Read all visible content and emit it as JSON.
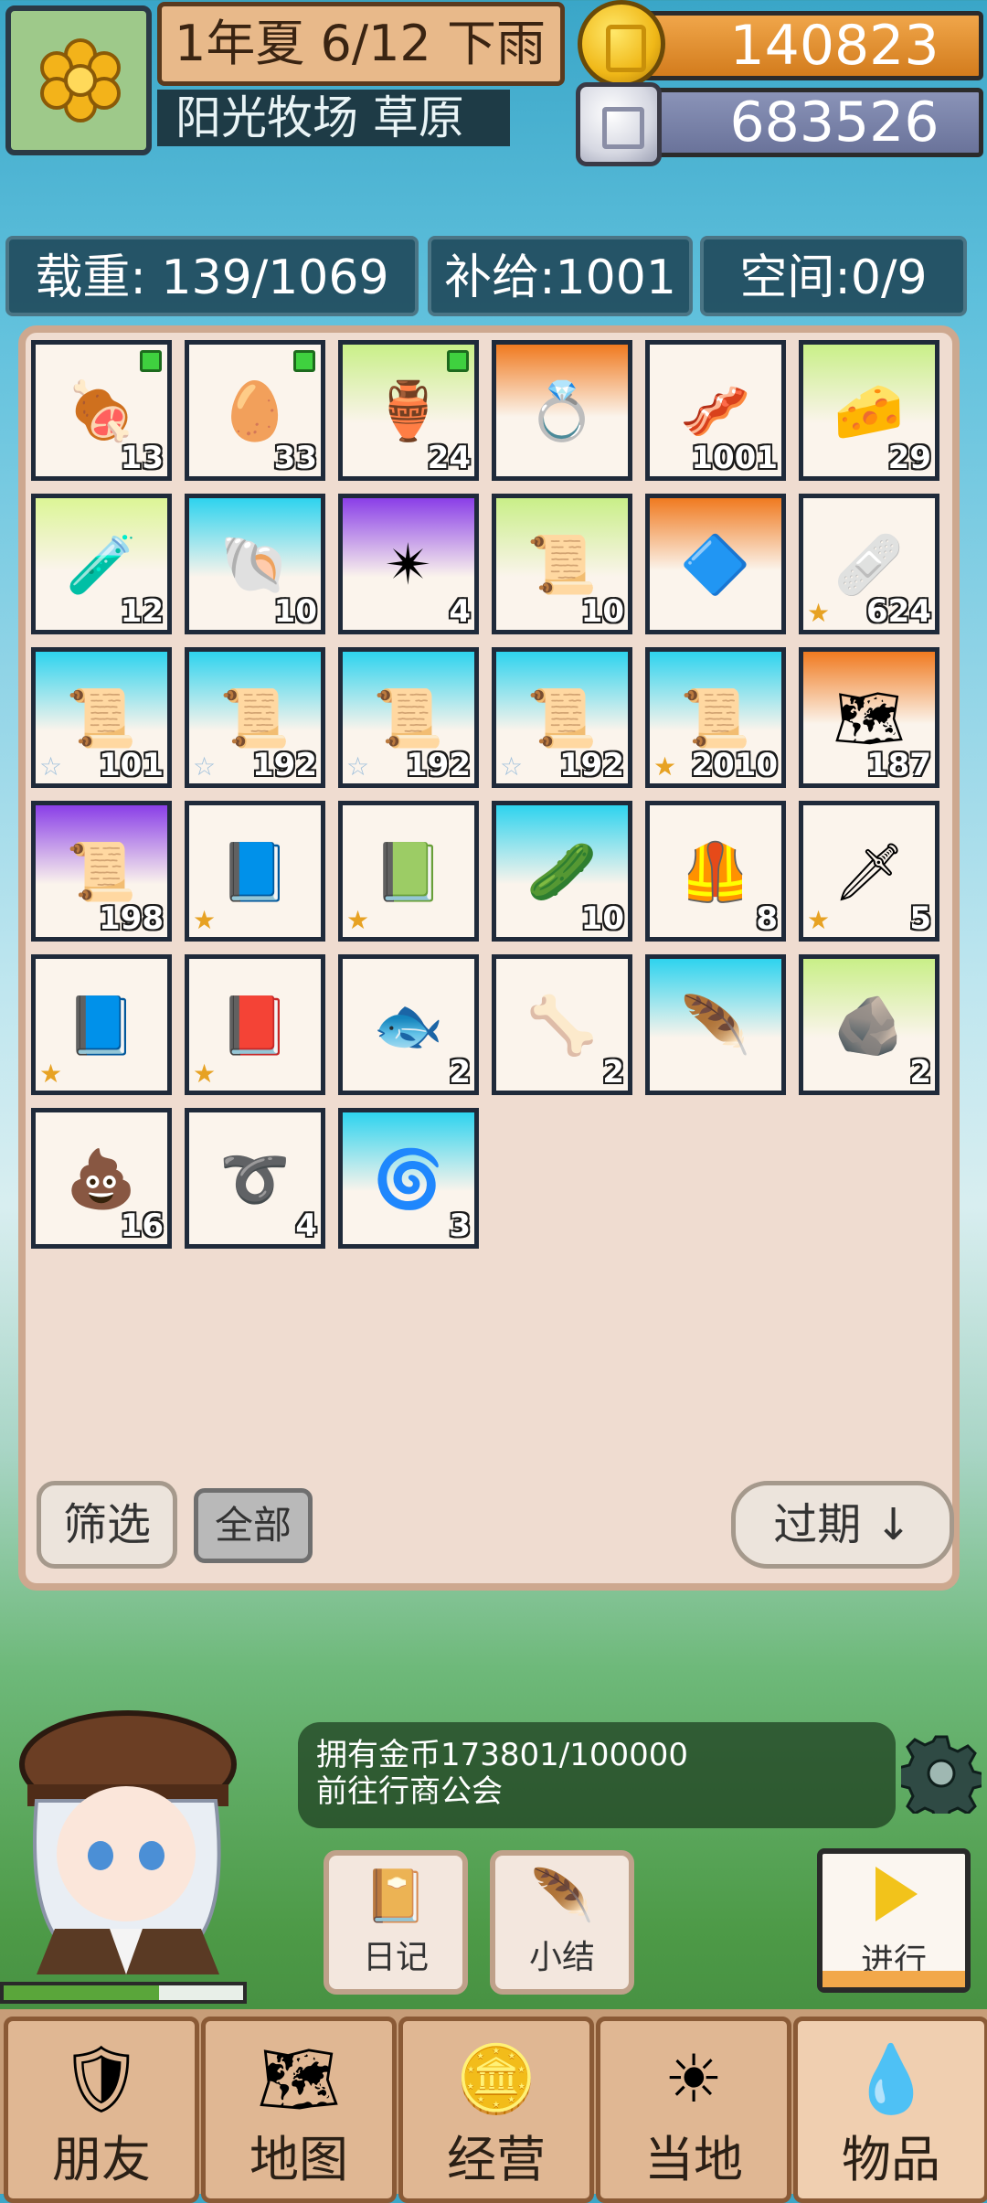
{
  "header": {
    "date": "1年夏 6/12 下雨",
    "location": "阳光牧场 草原",
    "gold": "140823",
    "silver": "683526"
  },
  "stats": {
    "weight": "载重: 139/1069",
    "supply": "补给:1001",
    "space": "空间:0/9"
  },
  "inventory": {
    "items": [
      {
        "icon": "meat-skewer-icon",
        "glyph": "🍖",
        "qty": "13",
        "bg": "#fbf4ec",
        "new": true,
        "star": ""
      },
      {
        "icon": "egg-icon",
        "glyph": "🥚",
        "qty": "33",
        "bg": "#fbf4ec",
        "new": true,
        "star": ""
      },
      {
        "icon": "clay-pot-icon",
        "glyph": "🏺",
        "qty": "24",
        "bg": "linear-gradient(180deg,#c9ef88,#fbf4ec 60%)",
        "new": true,
        "star": ""
      },
      {
        "icon": "ring-icon",
        "glyph": "💍",
        "qty": "",
        "bg": "linear-gradient(180deg,#f07a20,#fbf4ec 55%)",
        "new": false,
        "star": ""
      },
      {
        "icon": "sausage-icon",
        "glyph": "🥓",
        "qty": "1001",
        "bg": "#fbf4ec",
        "new": false,
        "star": ""
      },
      {
        "icon": "cheese-icon",
        "glyph": "🧀",
        "qty": "29",
        "bg": "linear-gradient(180deg,#c9ef88,#fbf4ec 60%)",
        "new": false,
        "star": ""
      },
      {
        "icon": "potion-bottle-icon",
        "glyph": "🧪",
        "qty": "12",
        "bg": "linear-gradient(180deg,#dcf596,#fbf4ec 55%)",
        "new": false,
        "star": ""
      },
      {
        "icon": "shell-icon",
        "glyph": "🐚",
        "qty": "10",
        "bg": "linear-gradient(180deg,#2ed3ee,#fbf4ec 60%)",
        "new": false,
        "star": ""
      },
      {
        "icon": "compass-star-icon",
        "glyph": "✴",
        "qty": "4",
        "bg": "linear-gradient(180deg,#8a3fe8,#fbf4ec 60%)",
        "new": false,
        "star": ""
      },
      {
        "icon": "paper-note-icon",
        "glyph": "📜",
        "qty": "10",
        "bg": "linear-gradient(180deg,#c9ef88,#fbf4ec 60%)",
        "new": false,
        "star": ""
      },
      {
        "icon": "crystal-pendant-icon",
        "glyph": "🔷",
        "qty": "",
        "bg": "linear-gradient(180deg,#f07a20,#fbf4ec 55%)",
        "new": false,
        "star": ""
      },
      {
        "icon": "medkit-icon",
        "glyph": "🩹",
        "qty": "624",
        "bg": "#fbf4ec",
        "new": false,
        "star": "★"
      },
      {
        "icon": "scroll-black-icon",
        "glyph": "📜",
        "qty": "101",
        "bg": "linear-gradient(180deg,#2ed3ee,#fbf4ec 60%)",
        "new": false,
        "star": "☆"
      },
      {
        "icon": "scroll-purple-icon",
        "glyph": "📜",
        "qty": "192",
        "bg": "linear-gradient(180deg,#2ed3ee,#fbf4ec 60%)",
        "new": false,
        "star": "☆"
      },
      {
        "icon": "scroll-green-icon",
        "glyph": "📜",
        "qty": "192",
        "bg": "linear-gradient(180deg,#2ed3ee,#fbf4ec 60%)",
        "new": false,
        "star": "☆"
      },
      {
        "icon": "scroll-fire-icon",
        "glyph": "📜",
        "qty": "192",
        "bg": "linear-gradient(180deg,#2ed3ee,#fbf4ec 60%)",
        "new": false,
        "star": "☆"
      },
      {
        "icon": "scroll-wind-icon",
        "glyph": "📜",
        "qty": "2010",
        "bg": "linear-gradient(180deg,#2ed3ee,#fbf4ec 60%)",
        "new": false,
        "star": "★"
      },
      {
        "icon": "golden-map-icon",
        "glyph": "🗺",
        "qty": "187",
        "bg": "linear-gradient(180deg,#f07a20,#fbf4ec 55%)",
        "new": false,
        "star": ""
      },
      {
        "icon": "scroll-crystal-icon",
        "glyph": "📜",
        "qty": "198",
        "bg": "linear-gradient(180deg,#8a3fe8,#fbf4ec 60%)",
        "new": false,
        "star": ""
      },
      {
        "icon": "blue-book-icon",
        "glyph": "📘",
        "qty": "",
        "bg": "#fbf4ec",
        "new": false,
        "star": "★"
      },
      {
        "icon": "teal-book-icon",
        "glyph": "📗",
        "qty": "",
        "bg": "#fbf4ec",
        "new": false,
        "star": "★"
      },
      {
        "icon": "green-pepper-icon",
        "glyph": "🥒",
        "qty": "10",
        "bg": "linear-gradient(180deg,#2ed3ee,#fbf4ec 60%)",
        "new": false,
        "star": ""
      },
      {
        "icon": "armor-vest-icon",
        "glyph": "🦺",
        "qty": "8",
        "bg": "#fbf4ec",
        "new": false,
        "star": ""
      },
      {
        "icon": "dagger-icon",
        "glyph": "🗡",
        "qty": "5",
        "bg": "#fbf4ec",
        "new": false,
        "star": "★"
      },
      {
        "icon": "ice-tome-icon",
        "glyph": "📘",
        "qty": "",
        "bg": "#fbf4ec",
        "new": false,
        "star": "★"
      },
      {
        "icon": "skull-book-icon",
        "glyph": "📕",
        "qty": "",
        "bg": "#fbf4ec",
        "new": false,
        "star": "★"
      },
      {
        "icon": "blue-fish-icon",
        "glyph": "🐟",
        "qty": "2",
        "bg": "#fbf4ec",
        "new": false,
        "star": ""
      },
      {
        "icon": "bone-icon",
        "glyph": "🦴",
        "qty": "2",
        "bg": "#fbf4ec",
        "new": false,
        "star": ""
      },
      {
        "icon": "feather-icon",
        "glyph": "🪶",
        "qty": "",
        "bg": "linear-gradient(180deg,#2ed3ee,#fbf4ec 60%)",
        "new": false,
        "star": ""
      },
      {
        "icon": "rune-stone-icon",
        "glyph": "🪨",
        "qty": "2",
        "bg": "linear-gradient(180deg,#c9ef88,#fbf4ec 60%)",
        "new": false,
        "star": ""
      },
      {
        "icon": "dung-icon",
        "glyph": "💩",
        "qty": "16",
        "bg": "#fbf4ec",
        "new": false,
        "star": ""
      },
      {
        "icon": "rope-icon",
        "glyph": "➰",
        "qty": "4",
        "bg": "#fbf4ec",
        "new": false,
        "star": ""
      },
      {
        "icon": "coiled-whip-icon",
        "glyph": "🌀",
        "qty": "3",
        "bg": "linear-gradient(180deg,#2ed3ee,#fbf4ec 60%)",
        "new": false,
        "star": ""
      }
    ],
    "filter_label": "筛选",
    "all_label": "全部",
    "sort_label": "过期 ↓"
  },
  "message": {
    "text": "拥有金币173801/100000\n前往行商公会"
  },
  "player": {
    "hp_fraction": 0.65
  },
  "actions": {
    "diary_label": "日记",
    "summary_label": "小结",
    "proceed_label": "进行"
  },
  "nav": {
    "tabs": [
      {
        "label": "朋友",
        "icon": "shield-icon",
        "glyph": "🛡"
      },
      {
        "label": "地图",
        "icon": "map-icon",
        "glyph": "🗺"
      },
      {
        "label": "经营",
        "icon": "coin-stack-icon",
        "glyph": "🪙"
      },
      {
        "label": "当地",
        "icon": "sun-icon",
        "glyph": "☀"
      },
      {
        "label": "物品",
        "icon": "item-bag-icon",
        "glyph": "💧"
      }
    ],
    "active_index": 4
  },
  "colors": {
    "panel_bg": "#efdcd0",
    "slot_border": "#1f2a3a",
    "gold_bar": "#e3922f",
    "silver_bar": "#7a83a9"
  }
}
